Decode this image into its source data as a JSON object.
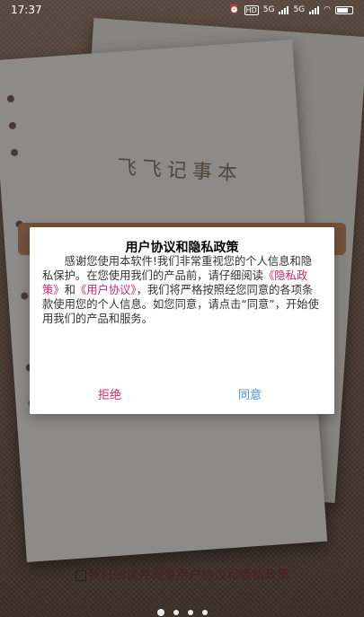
{
  "status_bar": {
    "time": "17:37",
    "hd_label": "HD",
    "net_label": "5G",
    "net2_label": "5G"
  },
  "background": {
    "app_title": "飞飞记事本",
    "bottom_text": "我已阅读并同意用户协议和隐私政策"
  },
  "dialog": {
    "title": "用户协议和隐私政策",
    "body_part1": "感谢您使用本软件!我们非常重视您的个人信息和隐私保护。在您使用我们的产品前，请仔细阅读",
    "privacy_link": "《隐私政策》",
    "and_text": "和",
    "agreement_link": "《用户协议》",
    "body_part2": "，我们将严格按照经您同意的各项条款使用您的个人信息。如您同意，请点击“同意”，开始使用我们的产品和服务。",
    "refuse_label": "拒绝",
    "agree_label": "同意"
  },
  "colors": {
    "link": "#d0286a",
    "agree": "#4a8fd6"
  }
}
